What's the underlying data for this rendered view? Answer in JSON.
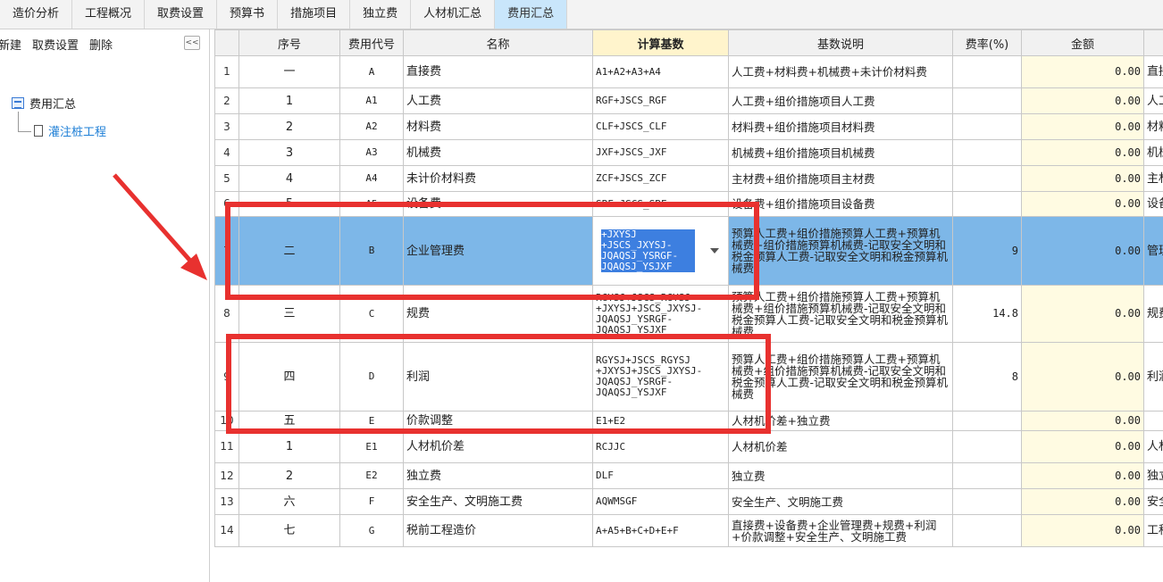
{
  "tabs": [
    "造价分析",
    "工程概况",
    "取费设置",
    "预算书",
    "措施项目",
    "独立费",
    "人材机汇总",
    "费用汇总"
  ],
  "active_tab": 7,
  "left_toolbar": {
    "new": "新建",
    "fee_setting": "取费设置",
    "delete": "删除",
    "collapse": "<<"
  },
  "tree": {
    "root": "费用汇总",
    "child": "灌注桩工程"
  },
  "columns": [
    "序号",
    "费用代号",
    "名称",
    "计算基数",
    "基数说明",
    "费率(%)",
    "金额",
    ""
  ],
  "rows": [
    {
      "idx": "1",
      "seq": "一",
      "code": "A",
      "name": "直接费",
      "base": "A1+A2+A3+A4",
      "desc": "人工费+材料费+机械费+未计价材料费",
      "rate": "",
      "amount": "0.00",
      "note": "直接"
    },
    {
      "idx": "2",
      "seq": "1",
      "code": "A1",
      "name": "人工费",
      "base": "RGF+JSCS_RGF",
      "desc": "人工费+组价措施项目人工费",
      "rate": "",
      "amount": "0.00",
      "note": "人工"
    },
    {
      "idx": "3",
      "seq": "2",
      "code": "A2",
      "name": "材料费",
      "base": "CLF+JSCS_CLF",
      "desc": "材料费+组价措施项目材料费",
      "rate": "",
      "amount": "0.00",
      "note": "材料"
    },
    {
      "idx": "4",
      "seq": "3",
      "code": "A3",
      "name": "机械费",
      "base": "JXF+JSCS_JXF",
      "desc": "机械费+组价措施项目机械费",
      "rate": "",
      "amount": "0.00",
      "note": "机械"
    },
    {
      "idx": "5",
      "seq": "4",
      "code": "A4",
      "name": "未计价材料费",
      "base": "ZCF+JSCS_ZCF",
      "desc": "主材费+组价措施项目主材费",
      "rate": "",
      "amount": "0.00",
      "note": "主材"
    },
    {
      "idx": "6",
      "seq": "5",
      "code": "A5",
      "name": "设备费",
      "base": "SBF+JSCS_SBF",
      "desc": "设备费+组价措施项目设备费",
      "rate": "",
      "amount": "0.00",
      "note": "设备"
    },
    {
      "idx": "7",
      "seq": "二",
      "code": "B",
      "name": "企业管理费",
      "base": "+JXYSJ +JSCS_JXYSJ- JQAQSJ_YSRGF- JQAQSJ_YSJXF",
      "desc": "预算人工费+组价措施预算人工费+预算机械费+组价措施预算机械费-记取安全文明和税金预算人工费-记取安全文明和税金预算机械费",
      "rate": "9",
      "amount": "0.00",
      "note": "管理"
    },
    {
      "idx": "8",
      "seq": "三",
      "code": "C",
      "name": "规费",
      "base": "RGYSJ+JSCS_RGYSJ +JXYSJ+JSCS_JXYSJ- JQAQSJ_YSRGF- JQAQSJ_YSJXF",
      "desc": "预算人工费+组价措施预算人工费+预算机械费+组价措施预算机械费-记取安全文明和税金预算人工费-记取安全文明和税金预算机械费",
      "rate": "14.8",
      "amount": "0.00",
      "note": "规费"
    },
    {
      "idx": "9",
      "seq": "四",
      "code": "D",
      "name": "利润",
      "base": "RGYSJ+JSCS_RGYSJ +JXYSJ+JSCS_JXYSJ- JQAQSJ_YSRGF- JQAQSJ_YSJXF",
      "desc": "预算人工费+组价措施预算人工费+预算机械费+组价措施预算机械费-记取安全文明和税金预算人工费-记取安全文明和税金预算机械费",
      "rate": "8",
      "amount": "0.00",
      "note": "利润"
    },
    {
      "idx": "10",
      "seq": "五",
      "code": "E",
      "name": "价款调整",
      "base": "E1+E2",
      "desc": "人材机价差+独立费",
      "rate": "",
      "amount": "0.00",
      "note": ""
    },
    {
      "idx": "11",
      "seq": "1",
      "code": "E1",
      "name": "人材机价差",
      "base": "RCJJC",
      "desc": "人材机价差",
      "rate": "",
      "amount": "0.00",
      "note": "人材"
    },
    {
      "idx": "12",
      "seq": "2",
      "code": "E2",
      "name": "独立费",
      "base": "DLF",
      "desc": "独立费",
      "rate": "",
      "amount": "0.00",
      "note": "独立"
    },
    {
      "idx": "13",
      "seq": "六",
      "code": "F",
      "name": "安全生产、文明施工费",
      "base": "AQWMSGF",
      "desc": "安全生产、文明施工费",
      "rate": "",
      "amount": "0.00",
      "note": "安全"
    },
    {
      "idx": "14",
      "seq": "七",
      "code": "G",
      "name": "税前工程造价",
      "base": "A+A5+B+C+D+E+F",
      "desc": "直接费+设备费+企业管理费+规费+利润+价款调整+安全生产、文明施工费",
      "rate": "",
      "amount": "0.00",
      "note": "工程"
    }
  ],
  "colors": {
    "accent": "#c9e6fb",
    "selected_row": "#7db7e8",
    "highlight": "#e8312f"
  }
}
